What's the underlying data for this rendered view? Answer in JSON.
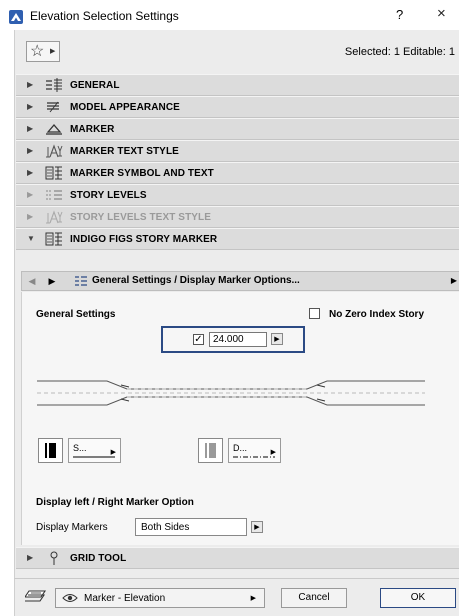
{
  "window": {
    "title": "Elevation Selection Settings",
    "help_label": "?",
    "close_label": "×"
  },
  "toolbar": {
    "selected_text": "Selected: 1 Editable: 1"
  },
  "panels": [
    {
      "label": "GENERAL",
      "expanded": false,
      "disabled": false
    },
    {
      "label": "MODEL APPEARANCE",
      "expanded": false,
      "disabled": false
    },
    {
      "label": "MARKER",
      "expanded": false,
      "disabled": false
    },
    {
      "label": "MARKER TEXT STYLE",
      "expanded": false,
      "disabled": false
    },
    {
      "label": "MARKER SYMBOL AND TEXT",
      "expanded": false,
      "disabled": false
    },
    {
      "label": "STORY LEVELS",
      "expanded": false,
      "disabled": true
    },
    {
      "label": "STORY LEVELS TEXT STYLE",
      "expanded": false,
      "disabled": true
    },
    {
      "label": "INDIGO FIGS STORY MARKER",
      "expanded": true,
      "disabled": false
    },
    {
      "label": "GRID TOOL",
      "expanded": false,
      "disabled": false
    }
  ],
  "subpage": {
    "label": "General Settings / Display Marker Options..."
  },
  "general_settings": {
    "title": "General Settings",
    "no_zero_index_label": "No Zero Index Story",
    "no_zero_index_checked": false,
    "index_checked": true,
    "index_value": "24.000",
    "left_symbol_label": "S...",
    "right_symbol_label": "D..."
  },
  "display_markers": {
    "section_title": "Display left / Right Marker Option",
    "label": "Display Markers",
    "value": "Both Sides"
  },
  "bottom": {
    "mode_value": "Marker - Elevation",
    "cancel_label": "Cancel",
    "ok_label": "OK"
  },
  "colors": {
    "focus_border": "#2b4a84",
    "panel_bg": "#dcdcdc",
    "content_bg": "#ececec"
  }
}
